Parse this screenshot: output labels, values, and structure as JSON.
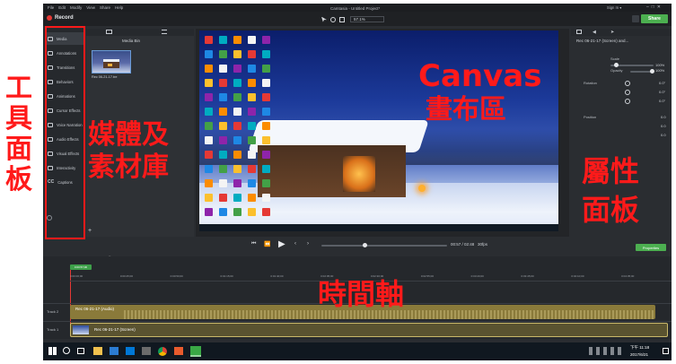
{
  "menubar": {
    "items": [
      "File",
      "Edit",
      "Modify",
      "View",
      "Share",
      "Help"
    ],
    "sign_in": "Sign In ▾"
  },
  "titlebar": {
    "record_label": "Record",
    "window_title": "Camtasia - Untitled Project*",
    "share_label": "Share",
    "zoom_value": "57.1%"
  },
  "sidebar": {
    "items": [
      {
        "label": "Media",
        "icon": "film-icon"
      },
      {
        "label": "Annotations",
        "icon": "annotation-icon"
      },
      {
        "label": "Transitions",
        "icon": "transition-icon"
      },
      {
        "label": "Behaviors",
        "icon": "behavior-icon"
      },
      {
        "label": "Animations",
        "icon": "animation-icon"
      },
      {
        "label": "Cursor Effects",
        "icon": "cursor-icon"
      },
      {
        "label": "Voice Narration",
        "icon": "mic-icon"
      },
      {
        "label": "Audio Effects",
        "icon": "speaker-icon"
      },
      {
        "label": "Visual Effects",
        "icon": "visual-effects-icon"
      },
      {
        "label": "Interactivity",
        "icon": "interactivity-icon"
      },
      {
        "label": "Captions",
        "icon": "cc-icon"
      }
    ]
  },
  "media_bin": {
    "header": "Media Bin",
    "clip_name": "Rec 06-21-17.tre"
  },
  "properties": {
    "clip_title": "Rec 06-21-17 (Screen) and...",
    "scale_label": "Scale",
    "scale_value": "100%",
    "opacity_label": "Opacity",
    "opacity_value": "100%",
    "rotation_label": "Rotation",
    "rot_z": "0.0°",
    "rot_y": "0.0°",
    "rot_x": "0.0°",
    "position_label": "Position",
    "pos_x": "0.0",
    "pos_y": "0.0",
    "pos_z": "0.0",
    "properties_button": "Properties"
  },
  "playback": {
    "time": "00:57 / 02:48",
    "fps": "30fps"
  },
  "timeline": {
    "playhead_time": "0:00:57;00",
    "ticks": [
      "0:00:00;00",
      "0:00:25;00",
      "0:00:50;00",
      "0:01:15;00",
      "0:01:40;00",
      "0:02:05;00",
      "0:02:30;00",
      "0:02:55;00",
      "0:03:20;00",
      "0:03:45;00",
      "0:04:10;00",
      "0:04:35;00"
    ],
    "tracks": [
      {
        "name": "Track 2",
        "clip": "Rec 06-21-17 (Audio)"
      },
      {
        "name": "Track 1",
        "clip": "Rec 06-21-17 (Screen)"
      }
    ]
  },
  "taskbar": {
    "time": "下午 11:18",
    "date": "2017/6/21"
  },
  "annotations": {
    "tools_panel": [
      "工",
      "具",
      "面",
      "板"
    ],
    "media_bin_line1": "媒體及",
    "media_bin_line2": "素材庫",
    "canvas_en": "Canvas",
    "canvas_zh": "畫布區",
    "props_line1": "屬性",
    "props_line2": "面板",
    "timeline": "時間軸"
  },
  "colors": {
    "accent_green": "#4caf50",
    "annotation_red": "#ff1a1a",
    "audio_track": "#8a7a3a",
    "screen_track": "#5a5330"
  }
}
